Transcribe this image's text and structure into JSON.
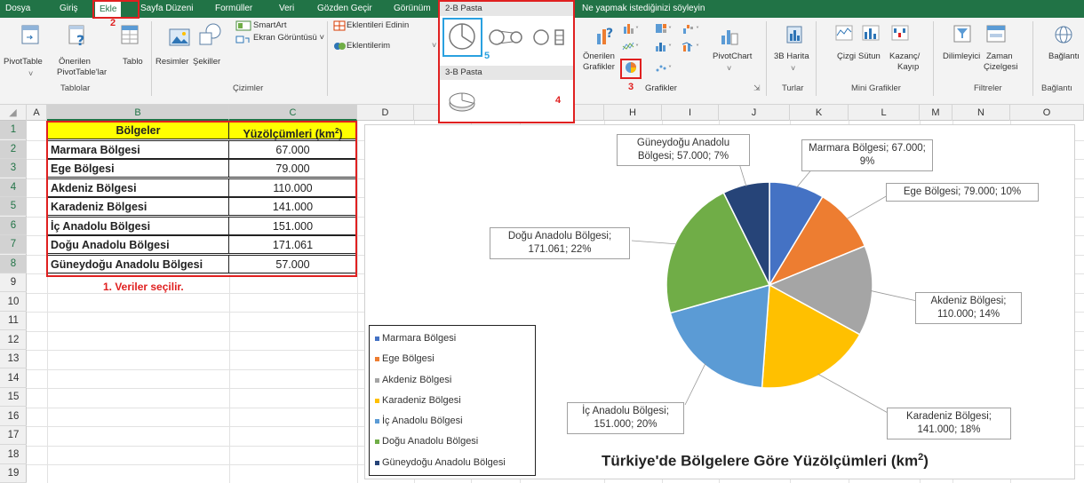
{
  "tabs": [
    "Dosya",
    "Giriş",
    "Ekle",
    "Sayfa Düzeni",
    "Formüller",
    "Veri",
    "Gözden Geçir",
    "Görünüm"
  ],
  "tell_me": "Ne yapmak istediğinizi söyleyin",
  "ribbon": {
    "pivottable": "PivotTable",
    "recommended_pivot_1": "Önerilen",
    "recommended_pivot_2": "PivotTable'lar",
    "table": "Tablo",
    "group_tables": "Tablolar",
    "pictures": "Resimler",
    "shapes": "Şekiller",
    "smartart": "SmartArt",
    "screenshot": "Ekran Görüntüsü ˅",
    "group_drawings": "Çizimler",
    "get_addins": "Eklentileri Edinin",
    "my_addins": "Eklentilerim",
    "recommended_charts_1": "Önerilen",
    "recommended_charts_2": "Grafikler",
    "group_charts": "Grafikler",
    "pivotchart": "PivotChart",
    "map3d": "3B Harita",
    "group_tours": "Turlar",
    "spark_line": "Çizgi",
    "spark_column": "Sütun",
    "spark_winloss_1": "Kazanç/",
    "spark_winloss_2": "Kayıp",
    "group_sparklines": "Mini Grafikler",
    "slicer": "Dilimleyici",
    "timeline_1": "Zaman",
    "timeline_2": "Çizelgesi",
    "group_filters": "Filtreler",
    "links": "Bağlantı",
    "group_links": "Bağlantı"
  },
  "pie_menu": {
    "header_2d": "2-B Pasta",
    "header_3d": "3-B Pasta"
  },
  "markers": {
    "m2": "2",
    "m3": "3",
    "m4": "4",
    "m5": "5"
  },
  "columns": [
    "A",
    "B",
    "C",
    "D",
    "E",
    "F",
    "G",
    "H",
    "I",
    "J",
    "K",
    "L",
    "M",
    "N",
    "O"
  ],
  "rows": [
    "1",
    "2",
    "3",
    "4",
    "5",
    "6",
    "7",
    "8",
    "9",
    "10",
    "11",
    "12",
    "13",
    "14",
    "15",
    "16",
    "17",
    "18",
    "19"
  ],
  "table": {
    "header_region": "Bölgeler",
    "header_area": "Yüzölçümleri (km",
    "header_area_sup": "2",
    "header_area_close": ")",
    "rows": [
      {
        "region": "Marmara Bölgesi",
        "area": "67.000"
      },
      {
        "region": "Ege Bölgesi",
        "area": "79.000"
      },
      {
        "region": "Akdeniz Bölgesi",
        "area": "110.000"
      },
      {
        "region": "Karadeniz Bölgesi",
        "area": "141.000"
      },
      {
        "region": "İç Anadolu Bölgesi",
        "area": "151.000"
      },
      {
        "region": "Doğu Anadolu Bölgesi",
        "area": "171.061"
      },
      {
        "region": "Güneydoğu Anadolu Bölgesi",
        "area": "57.000"
      }
    ]
  },
  "note": "1. Veriler seçilir.",
  "chart_data": {
    "type": "pie",
    "title": "Türkiye'de Bölgelere Göre Yüzölçümleri (km",
    "title_sup": "2",
    "title_close": ")",
    "categories": [
      "Marmara Bölgesi",
      "Ege Bölgesi",
      "Akdeniz Bölgesi",
      "Karadeniz Bölgesi",
      "İç Anadolu Bölgesi",
      "Doğu Anadolu Bölgesi",
      "Güneydoğu Anadolu Bölgesi"
    ],
    "values": [
      67000,
      79000,
      110000,
      141000,
      151000,
      171061,
      57000
    ],
    "colors": [
      "#4472c4",
      "#ed7d31",
      "#a5a5a5",
      "#ffc000",
      "#5b9bd5",
      "#70ad47",
      "#264478"
    ],
    "data_labels": [
      {
        "l1": "Marmara Bölgesi; 67.000;",
        "l2": "9%"
      },
      {
        "l1": "Ege Bölgesi; 79.000; 10%",
        "l2": ""
      },
      {
        "l1": "Akdeniz Bölgesi;",
        "l2": "110.000; 14%"
      },
      {
        "l1": "Karadeniz Bölgesi;",
        "l2": "141.000; 18%"
      },
      {
        "l1": "İç Anadolu Bölgesi;",
        "l2": "151.000; 20%"
      },
      {
        "l1": "Doğu Anadolu Bölgesi;",
        "l2": "171.061; 22%"
      },
      {
        "l1": "Güneydoğu Anadolu",
        "l2": "Bölgesi; 57.000; 7%"
      }
    ],
    "legend_position": "left-bottom"
  }
}
